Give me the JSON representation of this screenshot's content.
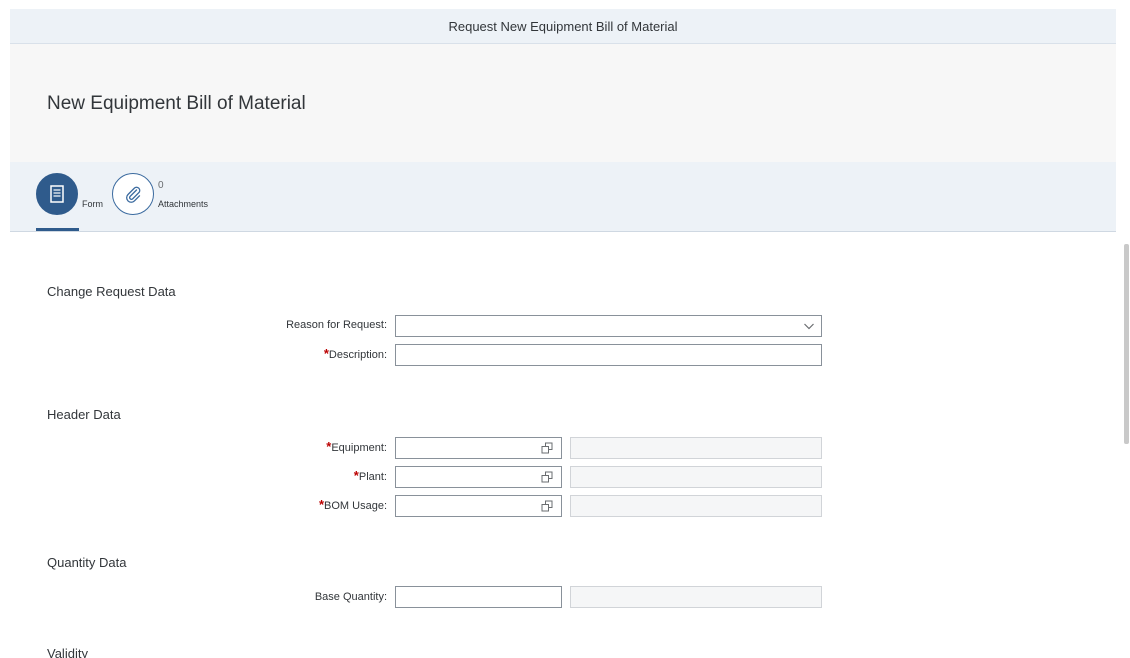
{
  "shell": {
    "title": "Request New Equipment Bill of Material"
  },
  "header": {
    "title": "New Equipment Bill of Material"
  },
  "tabs": {
    "form": {
      "label": "Form",
      "icon": "form-icon"
    },
    "attachments": {
      "label": "Attachments",
      "count": "0",
      "icon": "paperclip-icon"
    }
  },
  "sections": {
    "change_request": {
      "title": "Change Request Data",
      "reason": {
        "label": "Reason for Request:",
        "value": ""
      },
      "description": {
        "label": "Description:",
        "value": "",
        "required": true
      }
    },
    "header_data": {
      "title": "Header Data",
      "equipment": {
        "label": "Equipment:",
        "value": "",
        "required": true
      },
      "plant": {
        "label": "Plant:",
        "value": "",
        "required": true
      },
      "bom_usage": {
        "label": "BOM Usage:",
        "value": "",
        "required": true
      }
    },
    "quantity": {
      "title": "Quantity Data",
      "base_quantity": {
        "label": "Base Quantity:",
        "value": ""
      }
    },
    "validity": {
      "title": "Validity"
    }
  },
  "required_marker": "*",
  "colors": {
    "accent": "#2f5b8c",
    "required": "#bb0000",
    "shell_bg": "#edf2f7"
  }
}
